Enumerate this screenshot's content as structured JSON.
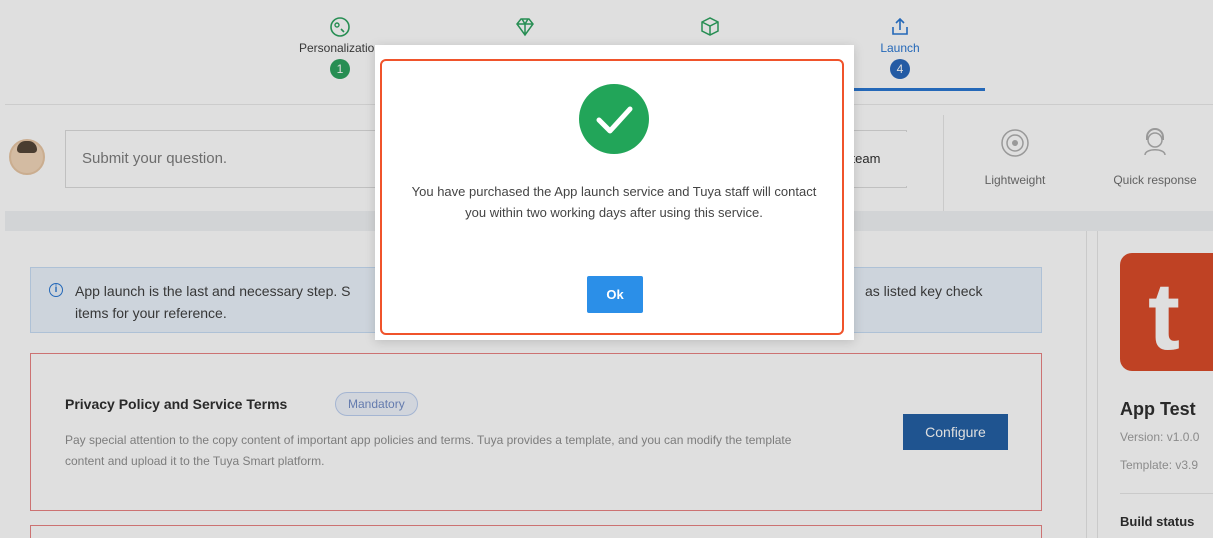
{
  "stepper": {
    "steps": [
      {
        "label": "Personalization",
        "number": "1",
        "icon": "palette-icon"
      },
      {
        "label": "",
        "number": "",
        "icon": "diamond-icon"
      },
      {
        "label": "",
        "number": "",
        "icon": "box-icon"
      },
      {
        "label": "Launch",
        "number": "4",
        "icon": "upload-tray-icon"
      }
    ]
  },
  "question": {
    "placeholder": "Submit your question.",
    "team_button": "team"
  },
  "features": [
    {
      "label": "Lightweight",
      "icon": "target-icon"
    },
    {
      "label": "Quick response",
      "icon": "agent-icon"
    }
  ],
  "notice": {
    "text_start": "App launch is the last and necessary step. S",
    "text_end": "as listed key check",
    "text_line2": "items for your reference."
  },
  "policy": {
    "title": "Privacy Policy and Service Terms",
    "tag": "Mandatory",
    "description": "Pay special attention to the copy content of important app policies and terms. Tuya provides a template, and you can modify the template content and upload it to the Tuya Smart platform.",
    "configure_label": "Configure"
  },
  "app": {
    "name": "App Test",
    "version": "Version: v1.0.0",
    "template": "Template: v3.9",
    "build_status_label": "Build status",
    "icon_letter": "t"
  },
  "modal": {
    "message": "You have purchased the App launch service and Tuya staff will contact you within two working days after using this service.",
    "ok_label": "Ok"
  },
  "colors": {
    "accent_blue": "#1b6ed0",
    "success_green": "#22a559",
    "highlight_red": "#f0532b",
    "brand_orange": "#d8401c"
  }
}
